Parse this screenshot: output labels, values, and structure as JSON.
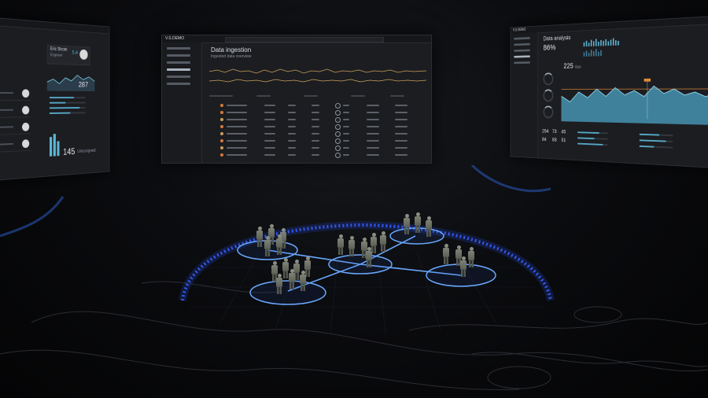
{
  "left_panel": {
    "profile_name": "Eric Strom",
    "profile_role": "Engineer",
    "profile_badge": "5.4",
    "stat_primary": "287",
    "stat_footer_value": "145",
    "stat_footer_label": "Unassigned"
  },
  "center_panel": {
    "brand": "V.S.DEMO",
    "title": "Data ingestion",
    "subtitle": "Ingested data overview",
    "rows": 8
  },
  "right_panel": {
    "brand": "V.S.DEMO",
    "title": "Data analysis",
    "percent": "86%",
    "reading": "225",
    "reading_unit": "kbps",
    "stat_a": "254",
    "stat_b": "73",
    "stat_c": "45",
    "stat_d": "84",
    "stat_e": "83",
    "stat_f": "51",
    "chart_color": "#5fb6d6",
    "accent": "#e28a3a"
  },
  "floor": {
    "ring_color": "#3b66ff",
    "node_color": "#5aa7ff"
  }
}
